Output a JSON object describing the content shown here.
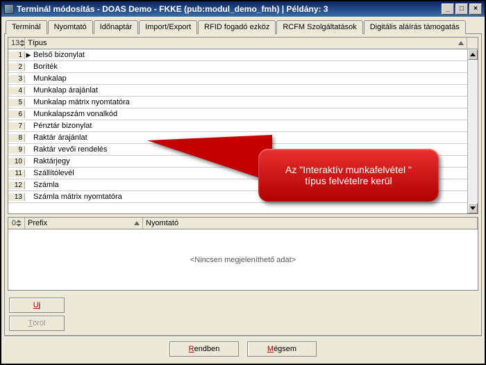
{
  "window": {
    "title": "Terminál módosítás - DOAS Demo - FKKE (pub:modul_demo_fmh) | Példány: 3",
    "min": "_",
    "max": "□",
    "close": "×"
  },
  "tabs": [
    "Terminál",
    "Nyomtató",
    "Időnaptár",
    "Import/Export",
    "RFID fogadó ezköz",
    "RCFM Szolgáltatások",
    "Digitális aláírás támogatás"
  ],
  "activeTab": 1,
  "upperGrid": {
    "headerCount": "13",
    "headerType": "Típus",
    "rows": [
      {
        "n": "1",
        "marker": "▶",
        "label": "Belső bizonylat"
      },
      {
        "n": "2",
        "marker": "",
        "label": "Boríték"
      },
      {
        "n": "3",
        "marker": "",
        "label": "Munkalap"
      },
      {
        "n": "4",
        "marker": "",
        "label": "Munkalap árajánlat"
      },
      {
        "n": "5",
        "marker": "",
        "label": "Munkalap mátrix nyomtatóra"
      },
      {
        "n": "6",
        "marker": "",
        "label": "Munkalapszám vonalkód"
      },
      {
        "n": "7",
        "marker": "",
        "label": "Pénztár bizonylat"
      },
      {
        "n": "8",
        "marker": "",
        "label": "Raktár árajánlat"
      },
      {
        "n": "9",
        "marker": "",
        "label": "Raktár vevői rendelés"
      },
      {
        "n": "10",
        "marker": "",
        "label": "Raktárjegy"
      },
      {
        "n": "11",
        "marker": "",
        "label": "Szállítólevél"
      },
      {
        "n": "12",
        "marker": "",
        "label": "Számla"
      },
      {
        "n": "13",
        "marker": "",
        "label": "Számla mátrix nyomtatóra"
      }
    ]
  },
  "lowerGrid": {
    "headerCount": "0",
    "colPrefix": "Prefix",
    "colPrinter": "Nyomtató",
    "noData": "<Nincsen megjeleníthető adat>"
  },
  "buttons": {
    "new_accel": "U",
    "new_rest": "j",
    "del_accel": "T",
    "del_rest": "öröl"
  },
  "bottom": {
    "ok_accel": "R",
    "ok_rest": "endben",
    "cancel_accel": "M",
    "cancel_rest": "égsem"
  },
  "callout": {
    "line1": "Az \"Interaktív munkafelvétel \"",
    "line2": "típus felvételre kerül"
  }
}
